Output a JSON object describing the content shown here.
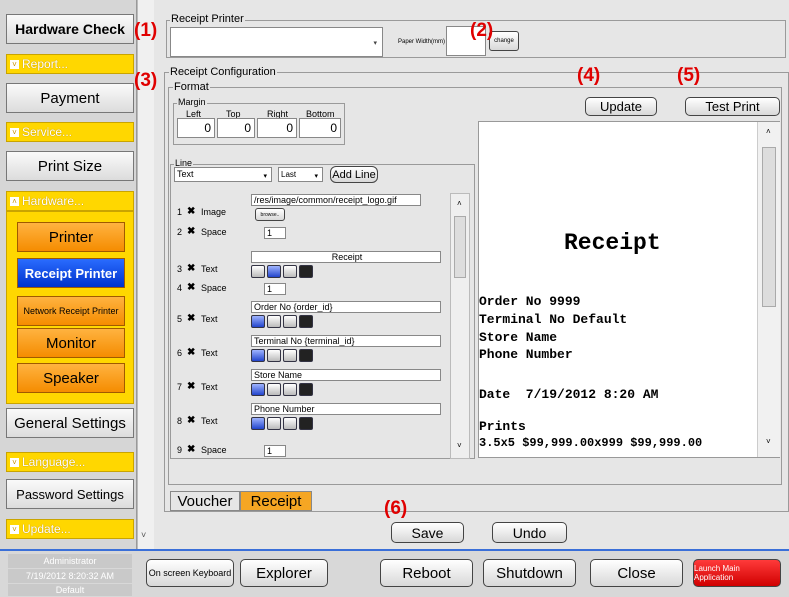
{
  "sidebar": {
    "hardware_check": "Hardware Check",
    "report": "Report...",
    "payment": "Payment",
    "service": "Service...",
    "print_size": "Print Size",
    "hardware": "Hardware...",
    "printer": "Printer",
    "receipt_printer": "Receipt Printer",
    "network_receipt_printer": "Network Receipt Printer",
    "monitor": "Monitor",
    "speaker": "Speaker",
    "general_settings": "General Settings",
    "language": "Language...",
    "password_settings": "Password Settings",
    "update": "Update..."
  },
  "receipt_printer": {
    "label": "Receipt Printer",
    "paper_width_label": "Paper Width(mm)",
    "change_label": "change"
  },
  "config": {
    "label": "Receipt Configuration",
    "format_label": "Format",
    "margin_label": "Margin",
    "margin": [
      {
        "label": "Left",
        "value": "0"
      },
      {
        "label": "Top",
        "value": "0"
      },
      {
        "label": "Right",
        "value": "0"
      },
      {
        "label": "Bottom",
        "value": "0"
      }
    ],
    "line_label": "Line",
    "line_type": "Text",
    "line_pos": "Last",
    "add_line": "Add Line",
    "browse": "browse..",
    "rows": [
      {
        "num": "1",
        "type": "Image",
        "value": "/res/image/common/receipt_logo.gif"
      },
      {
        "num": "2",
        "type": "Space",
        "value": "1"
      },
      {
        "num": "3",
        "type": "Text",
        "value": "Receipt"
      },
      {
        "num": "4",
        "type": "Space",
        "value": "1"
      },
      {
        "num": "5",
        "type": "Text",
        "value": "Order No {order_id}"
      },
      {
        "num": "6",
        "type": "Text",
        "value": "Terminal No {terminal_id}"
      },
      {
        "num": "7",
        "type": "Text",
        "value": "Store Name"
      },
      {
        "num": "8",
        "type": "Text",
        "value": "Phone Number"
      },
      {
        "num": "9",
        "type": "Space",
        "value": "1"
      }
    ],
    "update": "Update",
    "test_print": "Test Print"
  },
  "preview": {
    "title": "Receipt",
    "lines": [
      "Order No 9999",
      "Terminal No Default",
      "Store Name",
      "Phone Number",
      "Date  7/19/2012 8:20 AM",
      "Prints",
      "3.5x5 $99,999.00x999 $99,999.00"
    ]
  },
  "tabs": {
    "voucher": "Voucher",
    "receipt": "Receipt"
  },
  "actions": {
    "save": "Save",
    "undo": "Undo"
  },
  "annotations": [
    "(1)",
    "(2)",
    "(3)",
    "(4)",
    "(5)",
    "(6)"
  ],
  "footer": {
    "user": "Administrator",
    "datetime": "7/19/2012 8:20:32 AM",
    "profile": "Default",
    "keyboard": "On screen Keyboard",
    "explorer": "Explorer",
    "reboot": "Reboot",
    "shutdown": "Shutdown",
    "close": "Close",
    "launch": "Launch Main Application"
  }
}
